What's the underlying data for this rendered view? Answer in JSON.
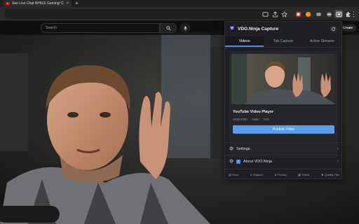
{
  "browser": {
    "tab_title": "See Live Chat WHILE Gaming! C",
    "new_tab_glyph": "+",
    "close_glyph": "×"
  },
  "youtube": {
    "search_placeholder": "Search",
    "create_label": "Create"
  },
  "popup": {
    "title": "VDO.Ninja Capture",
    "tabs": [
      {
        "label": "Videos",
        "active": true
      },
      {
        "label": "Tab Capture",
        "active": false
      },
      {
        "label": "Active Streams",
        "active": false
      }
    ],
    "video_card": {
      "title": "YouTube Video Player",
      "meta": [
        "1920x1080",
        "Audio",
        "3:49"
      ],
      "publish_label": "Publish Video"
    },
    "settings_label": "Settings",
    "about_label": "About VDO.Ninja",
    "footer_links": [
      {
        "icon": "docs-icon",
        "label": "Docs"
      },
      {
        "icon": "support-icon",
        "label": "Support"
      },
      {
        "icon": "privacy-icon",
        "label": "Privacy"
      },
      {
        "icon": "terms-icon",
        "label": "Terms"
      },
      {
        "icon": "star-icon",
        "label": "Quality Tips"
      }
    ]
  },
  "colors": {
    "accent": "#5b9be8",
    "tab_underline": "#4c8bf5",
    "youtube_red": "#ff0000",
    "popup_bg": "#1e1f22"
  }
}
